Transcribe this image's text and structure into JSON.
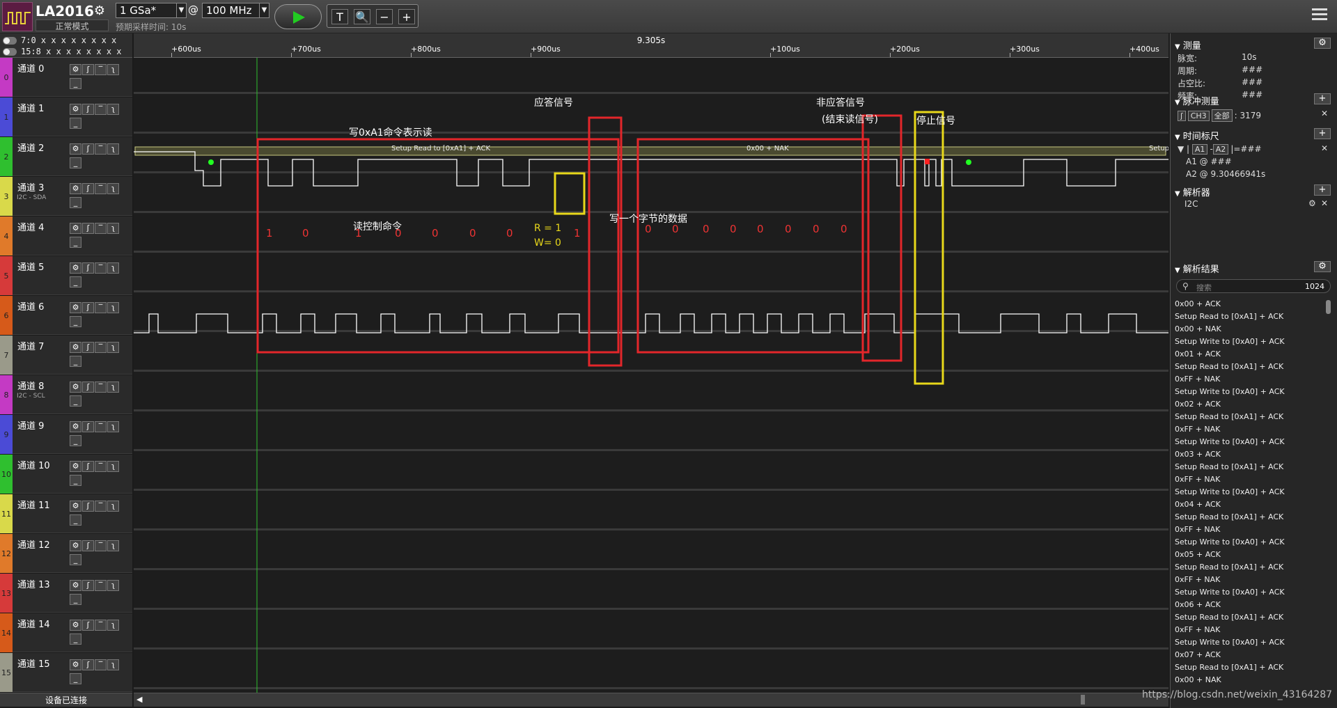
{
  "app": {
    "brand": "LA2016",
    "mode": "正常模式",
    "sample_rate": "1 GSa*",
    "at": "@",
    "threshold": "100 MHz",
    "estimate": "预期采样时间: 10s"
  },
  "toolbar": {
    "tools": [
      "T",
      "🔍",
      "−",
      "+"
    ]
  },
  "groups": [
    {
      "label": "7:0  x x x x x x x x"
    },
    {
      "label": "15:8  x x x x x x x x"
    }
  ],
  "channels": [
    {
      "name": "通道 0",
      "num": "0",
      "sub": "",
      "color": "#c43ac4"
    },
    {
      "name": "通道 1",
      "num": "1",
      "sub": "",
      "color": "#4b4bd6"
    },
    {
      "name": "通道 2",
      "num": "2",
      "sub": "",
      "color": "#2fbf2f"
    },
    {
      "name": "通道 3",
      "num": "3",
      "sub": "I2C - SDA",
      "color": "#d9d94a"
    },
    {
      "name": "通道 4",
      "num": "4",
      "sub": "",
      "color": "#e07a2a"
    },
    {
      "name": "通道 5",
      "num": "5",
      "sub": "",
      "color": "#d63a3a"
    },
    {
      "name": "通道 6",
      "num": "6",
      "sub": "",
      "color": "#d65a1a"
    },
    {
      "name": "通道 7",
      "num": "7",
      "sub": "",
      "color": "#9a9a8a"
    },
    {
      "name": "通道 8",
      "num": "8",
      "sub": "I2C - SCL",
      "color": "#c43ac4"
    },
    {
      "name": "通道 9",
      "num": "9",
      "sub": "",
      "color": "#4b4bd6"
    },
    {
      "name": "通道 10",
      "num": "10",
      "sub": "",
      "color": "#2fbf2f"
    },
    {
      "name": "通道 11",
      "num": "11",
      "sub": "",
      "color": "#d9d94a"
    },
    {
      "name": "通道 12",
      "num": "12",
      "sub": "",
      "color": "#e07a2a"
    },
    {
      "name": "通道 13",
      "num": "13",
      "sub": "",
      "color": "#d63a3a"
    },
    {
      "name": "通道 14",
      "num": "14",
      "sub": "",
      "color": "#d65a1a"
    },
    {
      "name": "通道 15",
      "num": "15",
      "sub": "",
      "color": "#9a9a8a"
    }
  ],
  "status": "设备已连接",
  "ruler": {
    "center": "9.305s",
    "ticks": [
      "+600us",
      "+700us",
      "+800us",
      "+900us",
      "+100us",
      "+200us",
      "+300us",
      "+400us"
    ]
  },
  "decode": {
    "frame1": "Setup Read to [0xA1] + ACK",
    "frame2": "0x00 + NAK",
    "frame3": "Setup"
  },
  "annotations": {
    "write_cmd": "写0xA1命令表示读",
    "read_ctrl": "读控制命令",
    "rw": "R = 1",
    "w": "W= 0",
    "ack": "应答信号",
    "nack": "非应答信号",
    "end_read": "(结束读信号)",
    "stop": "停止信号",
    "one_byte": "写一个字节的数据",
    "bits1": [
      "1",
      "0",
      "1",
      "0",
      "0",
      "0",
      "0",
      "1"
    ],
    "bits2": [
      "0",
      "0",
      "0",
      "0",
      "0",
      "0",
      "0",
      "0"
    ]
  },
  "panel": {
    "measure": {
      "title": "测量",
      "rows": [
        [
          "脉宽:",
          "10s"
        ],
        [
          "周期:",
          "###"
        ],
        [
          "占空比:",
          "###"
        ],
        [
          "频率:",
          "###"
        ]
      ]
    },
    "pulse": {
      "title": "脉冲测量",
      "ch": "CH3",
      "all": "全部",
      "count": ": 3179"
    },
    "cursor": {
      "title": "时间标尺",
      "a1": "A1",
      "a2": "A2",
      "eq": "|=###",
      "a1v": "A1 @ ###",
      "a2v": "A2 @ 9.30466941s"
    },
    "parser": {
      "title": "解析器",
      "name": "I2C"
    },
    "results": {
      "title": "解析结果",
      "search_placeholder": "搜索",
      "count": "1024",
      "items": [
        "0x00 + ACK",
        "Setup Read to [0xA1] + ACK",
        "0x00 + NAK",
        "Setup Write to [0xA0] + ACK",
        "0x01 + ACK",
        "Setup Read to [0xA1] + ACK",
        "0xFF + NAK",
        "Setup Write to [0xA0] + ACK",
        "0x02 + ACK",
        "Setup Read to [0xA1] + ACK",
        "0xFF + NAK",
        "Setup Write to [0xA0] + ACK",
        "0x03 + ACK",
        "Setup Read to [0xA1] + ACK",
        "0xFF + NAK",
        "Setup Write to [0xA0] + ACK",
        "0x04 + ACK",
        "Setup Read to [0xA1] + ACK",
        "0xFF + NAK",
        "Setup Write to [0xA0] + ACK",
        "0x05 + ACK",
        "Setup Read to [0xA1] + ACK",
        "0xFF + NAK",
        "Setup Write to [0xA0] + ACK",
        "0x06 + ACK",
        "Setup Read to [0xA1] + ACK",
        "0xFF + NAK",
        "Setup Write to [0xA0] + ACK",
        "0x07 + ACK",
        "Setup Read to [0xA1] + ACK",
        "0x00 + NAK"
      ]
    }
  },
  "watermark": "https://blog.csdn.net/weixin_43164287"
}
